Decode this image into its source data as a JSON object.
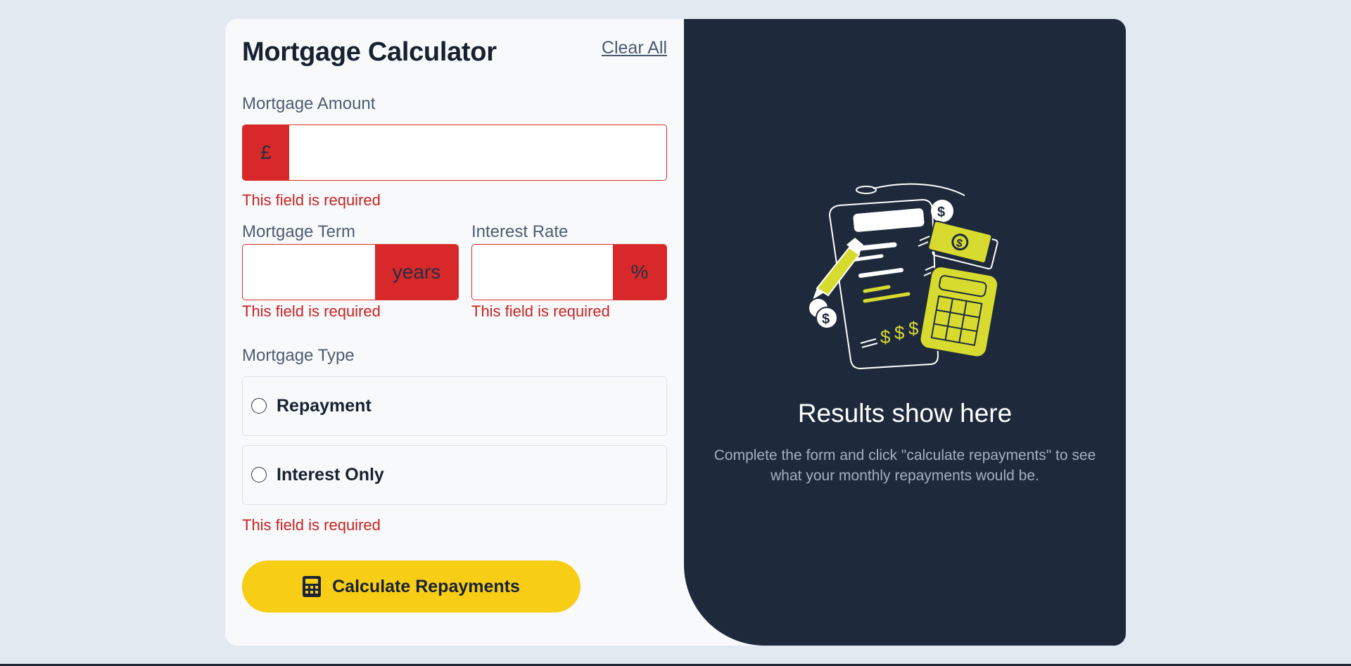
{
  "header": {
    "title": "Mortgage Calculator",
    "clear_all_label": "Clear All"
  },
  "form": {
    "amount": {
      "label": "Mortgage Amount",
      "prefix": "£",
      "value": "",
      "error": "This field is required"
    },
    "term": {
      "label": "Mortgage Term",
      "suffix": "years",
      "value": "",
      "error": "This field is required"
    },
    "rate": {
      "label": "Interest Rate",
      "suffix": "%",
      "value": "",
      "error": "This field is required"
    },
    "type": {
      "label": "Mortgage Type",
      "options": [
        {
          "label": "Repayment",
          "selected": false
        },
        {
          "label": "Interest Only",
          "selected": false
        }
      ],
      "error": "This field is required"
    },
    "submit_label": "Calculate Repayments",
    "submit_icon": "calculator-icon"
  },
  "results": {
    "illustration": "empty-results-illustration",
    "title": "Results show here",
    "description": "Complete the form and click \"calculate repayments\" to see what your monthly repayments would be."
  },
  "colors": {
    "page_bg": "#e3e9f0",
    "card_bg": "#f7f9fb",
    "panel_bg": "#1e2a3c",
    "accent_lime": "#d8db2f",
    "button_yellow": "#f8cd16",
    "error_red": "#d8282a",
    "text_dark": "#172130"
  }
}
